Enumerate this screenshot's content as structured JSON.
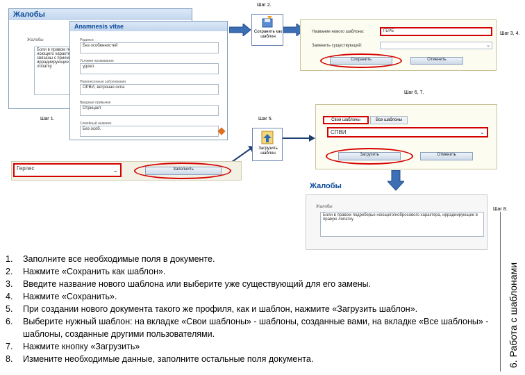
{
  "steps_labels": {
    "step1": "Шаг 1.",
    "step2": "Шаг 2.",
    "step34": "Шаг 3, 4.",
    "step5": "Шаг 5.",
    "step67": "Шаг 6, 7.",
    "step8": "Шаг 8."
  },
  "complaints_window": {
    "title": "Жалобы",
    "section_label": "Жалобы",
    "text": "Боли в правом подреберье, ноющего характера, не связаны с приемом пищи, иррадиирующие в правую лопатку"
  },
  "anamnesis_window": {
    "title": "Anamnesis vitae",
    "fields": [
      {
        "label": "Родился",
        "value": "Без особенностей"
      },
      {
        "label": "Условия проживания",
        "value": "удовл."
      },
      {
        "label": "Перенесенные заболевания",
        "value": "ОРВИ, ветряная оспа"
      },
      {
        "label": "Вредные привычки",
        "value": "Отрицает"
      },
      {
        "label": "Семейный анамнез",
        "value": "Без особ."
      }
    ]
  },
  "save_template_icon": {
    "label": "Сохранить как шаблон"
  },
  "load_template_icon": {
    "label": "Загрузить шаблон"
  },
  "save_dialog": {
    "new_name_label": "Название нового шаблона:",
    "new_name_value": "ГЕРБ",
    "existing_label": "Заменить существующий:",
    "save_button": "Сохранить",
    "cancel_button": "Отменить"
  },
  "load_dialog": {
    "tab_mine": "Свои шаблоны",
    "tab_all": "Все шаблоны",
    "selected_template": "СПВИ",
    "load_button": "Загрузить",
    "cancel_button": "Отменить"
  },
  "fill_bar": {
    "select_value": "Герпес",
    "fill_button": "Заполнить"
  },
  "result_window": {
    "title": "Жалобы",
    "section_label": "Жалобы",
    "text": "Боли в правом подреберье ноющего/нобросового характера, иррадиирующие в правую лопатку"
  },
  "instructions": [
    {
      "num": "1.",
      "text": "Заполните все необходимые поля в документе."
    },
    {
      "num": "2.",
      "text": "Нажмите «Сохранить как шаблон»."
    },
    {
      "num": "3.",
      "text": "Введите название нового шаблона или выберите уже существующий для его замены."
    },
    {
      "num": "4.",
      "text": "Нажмите «Сохранить»."
    },
    {
      "num": "5.",
      "text": "При создании нового документа такого же профиля, как и шаблон, нажмите «Загрузить шаблон»."
    },
    {
      "num": "6.",
      "text": "Выберите нужный шаблон: на вкладке «Свои шаблоны» - шаблоны, созданные вами, на вкладке «Все шаблоны» - шаблоны, созданные другими пользователями."
    },
    {
      "num": "7.",
      "text": "Нажмите кнопку «Загрузить»"
    },
    {
      "num": "8.",
      "text": "Измените необходимые данные, заполните остальные поля документа."
    }
  ],
  "side_title": "6. Работа с шаблонами",
  "colors": {
    "highlight": "#d40000",
    "arrow": "#3d6fb5",
    "window_title": "#0a4a9a"
  }
}
